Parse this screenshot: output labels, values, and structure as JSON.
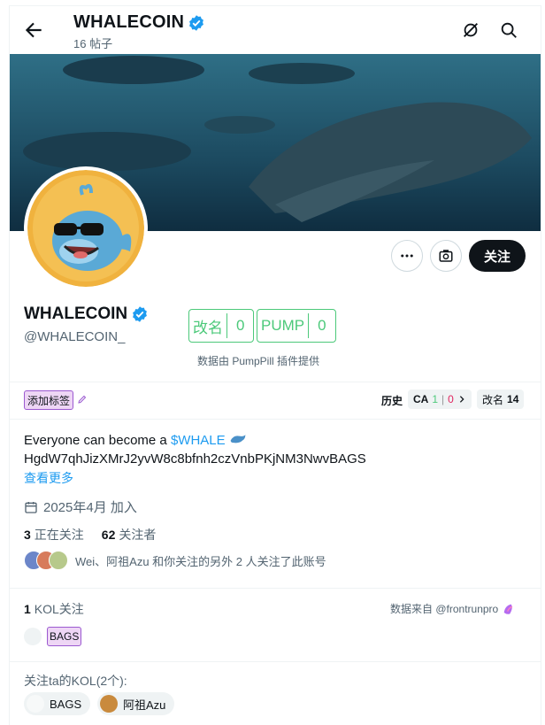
{
  "header": {
    "title": "WHALECOIN",
    "post_count": "16 帖子"
  },
  "profile": {
    "name": "WHALECOIN",
    "handle": "@WHALECOIN_",
    "follow_label": "关注"
  },
  "pumppill": {
    "rename_label": "改名",
    "rename_count": "0",
    "pump_label": "PUMP",
    "pump_count": "0",
    "note": "数据由 PumpPill 插件提供"
  },
  "tags": {
    "add_label": "添加标签",
    "history_label": "历史",
    "ca_label": "CA",
    "ca_green": "1",
    "ca_red": "0",
    "rename_label": "改名",
    "rename_count": "14"
  },
  "bio": {
    "line1_prefix": "Everyone can become a ",
    "cashtag": "$WHALE",
    "line2": "HgdW7qhJizXMrJ2yvW8c8bfnh2czVnbPKjNM3NwvBAGS",
    "more": "查看更多"
  },
  "joined": "2025年4月 加入",
  "stats": {
    "following_count": "3",
    "following_label": "正在关注",
    "followers_count": "62",
    "followers_label": "关注者"
  },
  "mutual_text": "Wei、阿祖Azu 和你关注的另外 2 人关注了此账号",
  "kol": {
    "count": "1",
    "label": "KOL关注",
    "source": "数据来自 @frontrunpro",
    "tag": "BAGS"
  },
  "followed_by": {
    "label": "关注ta的KOL(2个):",
    "items": [
      "BAGS",
      "阿祖Azu"
    ]
  },
  "colors": {
    "accent": "#1d9bf0",
    "pumppill_green": "#4cc97a",
    "tag_purple": "#9b59d0"
  }
}
